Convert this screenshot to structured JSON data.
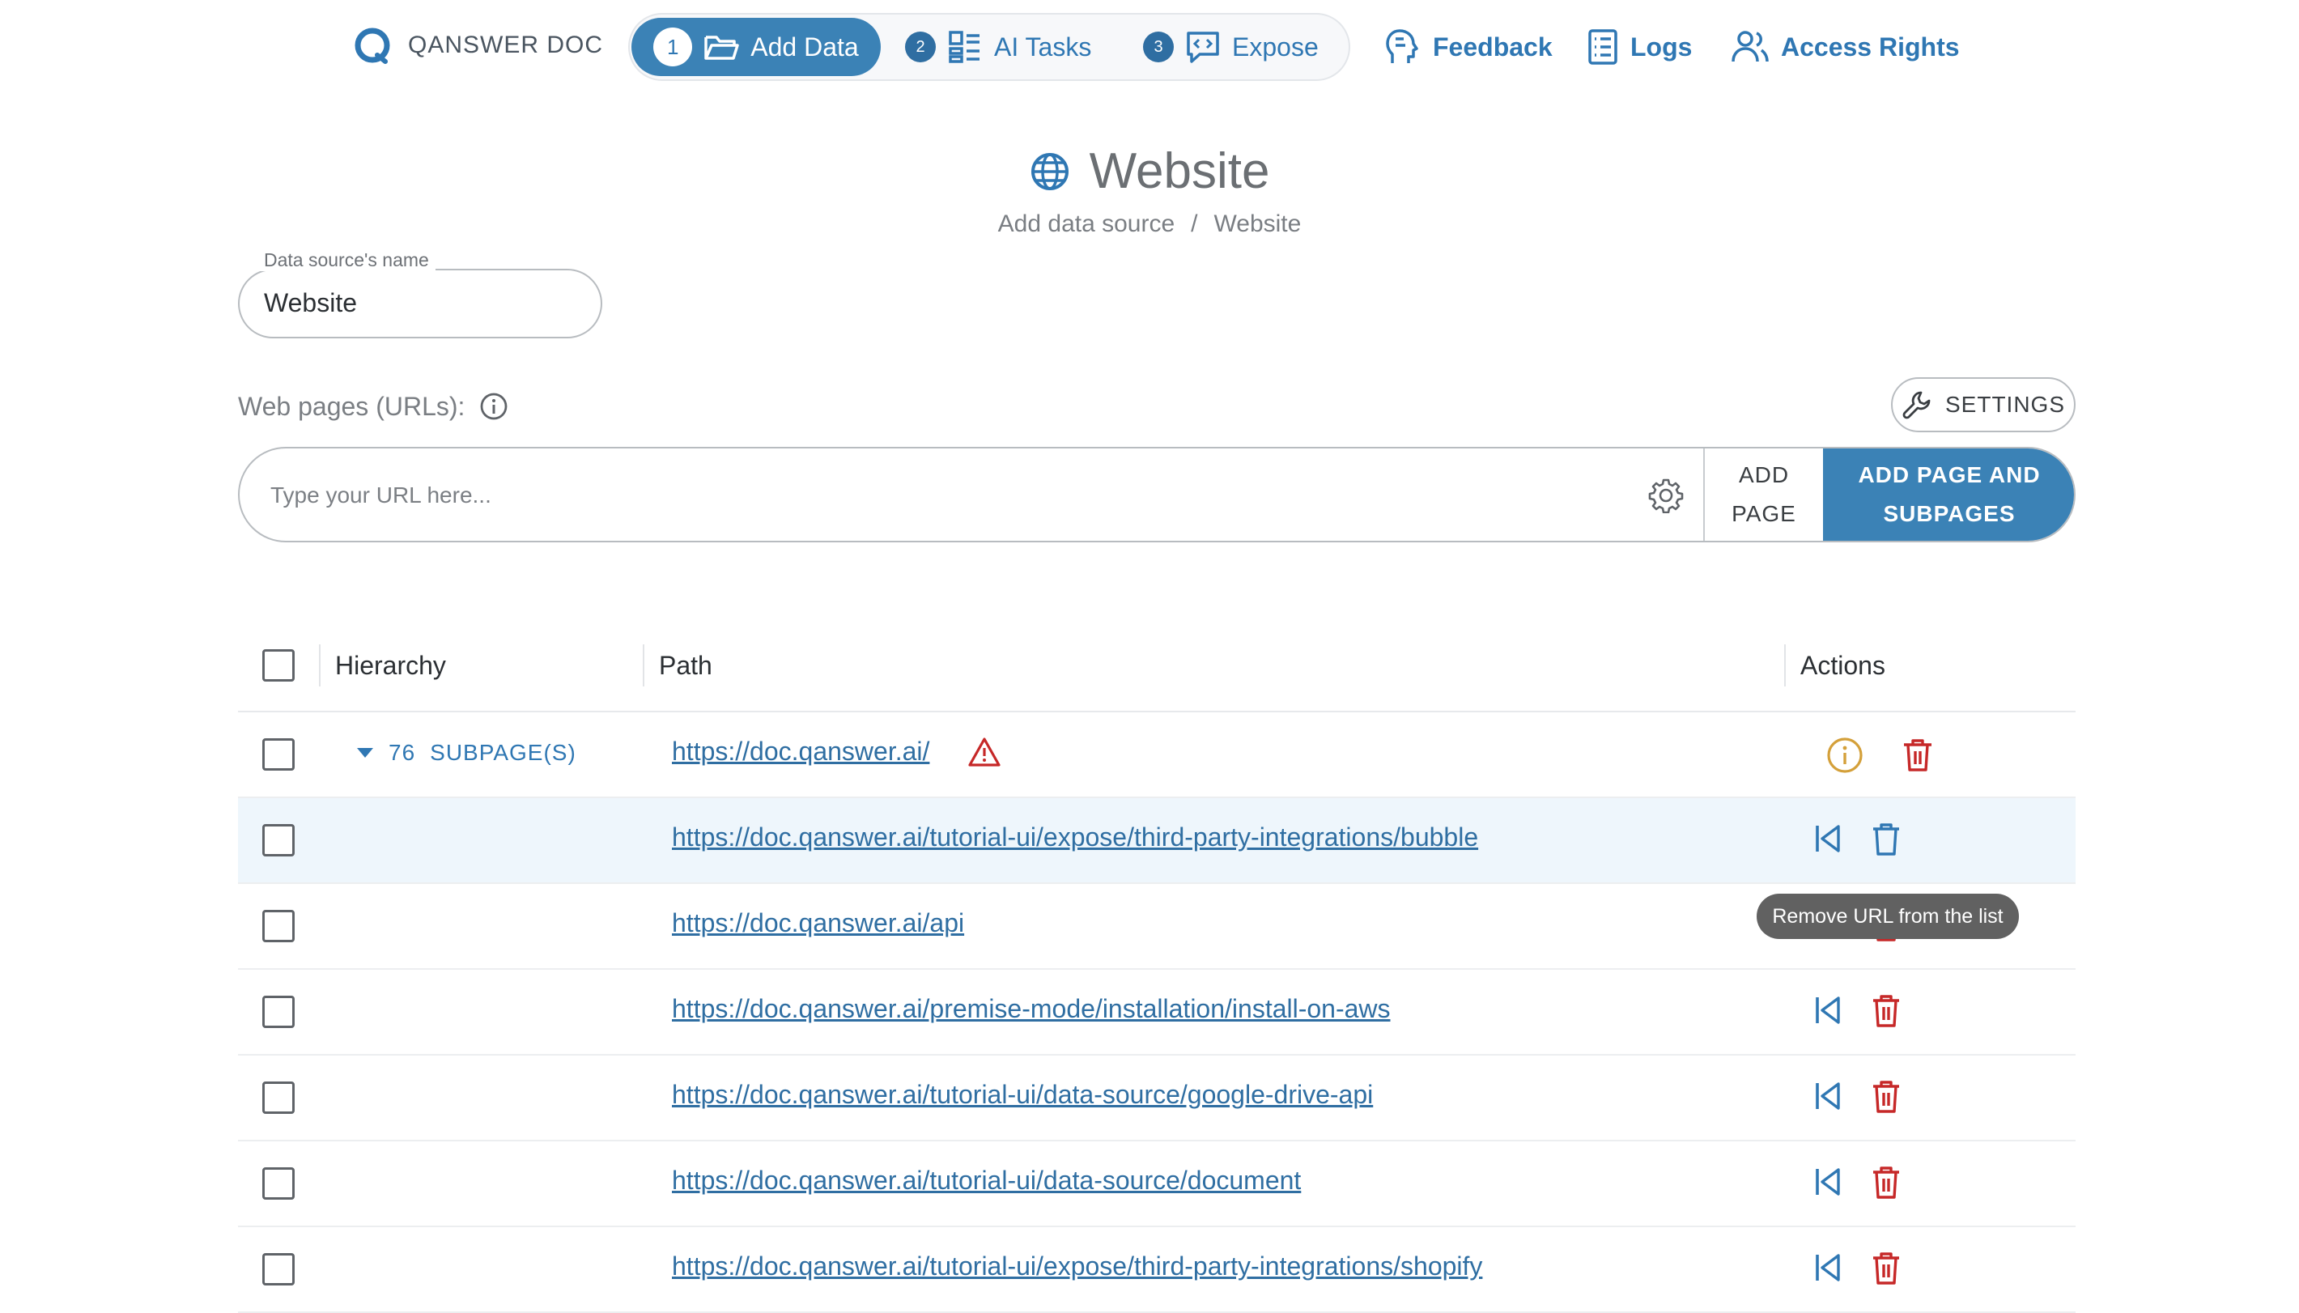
{
  "app": {
    "name": "QANSWER DOC"
  },
  "steps": [
    {
      "num": "1",
      "label": "Add Data"
    },
    {
      "num": "2",
      "label": "AI Tasks"
    },
    {
      "num": "3",
      "label": "Expose"
    }
  ],
  "nav": {
    "feedback": "Feedback",
    "logs": "Logs",
    "access": "Access Rights"
  },
  "page": {
    "title": "Website",
    "breadcrumb": [
      "Add data source",
      "/",
      "Website"
    ]
  },
  "name_field": {
    "label": "Data source's name",
    "value": "Website"
  },
  "urls_section": {
    "label": "Web pages (URLs):",
    "settings_label": "SETTINGS",
    "input_placeholder": "Type your URL here...",
    "add_page_line1": "ADD",
    "add_page_line2": "PAGE",
    "add_sub_line1": "ADD PAGE AND",
    "add_sub_line2": "SUBPAGES"
  },
  "table": {
    "headers": {
      "hierarchy": "Hierarchy",
      "path": "Path",
      "actions": "Actions"
    },
    "root": {
      "count": "76",
      "count_label": "SUBPAGE(S)",
      "url": "https://doc.qanswer.ai/"
    },
    "rows": [
      "https://doc.qanswer.ai/tutorial-ui/expose/third-party-integrations/bubble",
      "https://doc.qanswer.ai/api",
      "https://doc.qanswer.ai/premise-mode/installation/install-on-aws",
      "https://doc.qanswer.ai/tutorial-ui/data-source/google-drive-api",
      "https://doc.qanswer.ai/tutorial-ui/data-source/document",
      "https://doc.qanswer.ai/tutorial-ui/expose/third-party-integrations/shopify"
    ]
  },
  "tooltip": "Remove URL from the list",
  "colors": {
    "primary": "#3b82b6",
    "link": "#2f6ea2",
    "danger": "#c62828",
    "warning": "#d4a03a"
  }
}
